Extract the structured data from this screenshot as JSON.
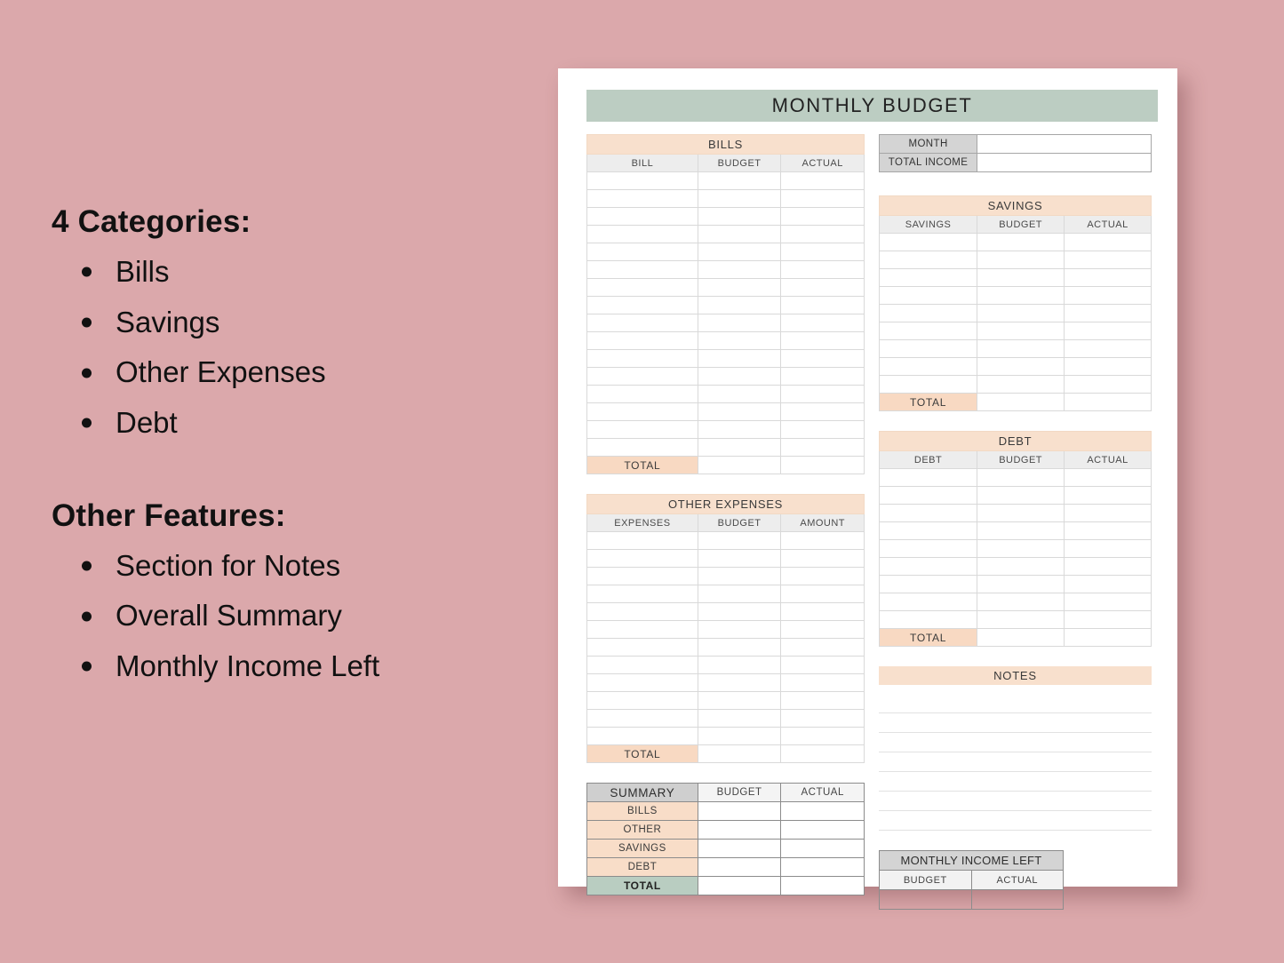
{
  "promo": {
    "section1": {
      "heading": "4 Categories:",
      "items": [
        "Bills",
        "Savings",
        "Other Expenses",
        "Debt"
      ]
    },
    "section2": {
      "heading": "Other Features:",
      "items": [
        "Section for Notes",
        "Overall Summary",
        "Monthly Income Left"
      ]
    }
  },
  "sheet": {
    "title": "MONTHLY BUDGET",
    "bills": {
      "band": "BILLS",
      "columns": [
        "BILL",
        "BUDGET",
        "ACTUAL"
      ],
      "rows": 16,
      "total_label": "TOTAL"
    },
    "other_expenses": {
      "band": "OTHER EXPENSES",
      "columns": [
        "EXPENSES",
        "BUDGET",
        "AMOUNT"
      ],
      "rows": 12,
      "total_label": "TOTAL"
    },
    "summary": {
      "title": "SUMMARY",
      "columns": [
        "BUDGET",
        "ACTUAL"
      ],
      "rows": [
        "BILLS",
        "OTHER",
        "SAVINGS",
        "DEBT"
      ],
      "total_label": "TOTAL"
    },
    "month_income": {
      "month_label": "MONTH",
      "income_label": "TOTAL INCOME",
      "month_value": "",
      "income_value": ""
    },
    "savings": {
      "band": "SAVINGS",
      "columns": [
        "SAVINGS",
        "BUDGET",
        "ACTUAL"
      ],
      "rows": 9,
      "total_label": "TOTAL"
    },
    "debt": {
      "band": "DEBT",
      "columns": [
        "DEBT",
        "BUDGET",
        "ACTUAL"
      ],
      "rows": 9,
      "total_label": "TOTAL"
    },
    "notes": {
      "band": "NOTES",
      "lines": 7
    },
    "monthly_income_left": {
      "title": "MONTHLY INCOME LEFT",
      "columns": [
        "BUDGET",
        "ACTUAL"
      ]
    }
  },
  "colors": {
    "background_pink": "#dba8ab",
    "banner_green": "#bccdc2",
    "band_peach": "#f8e0cd",
    "subhead_gray": "#ededed",
    "label_gray": "#d4d4d4"
  }
}
